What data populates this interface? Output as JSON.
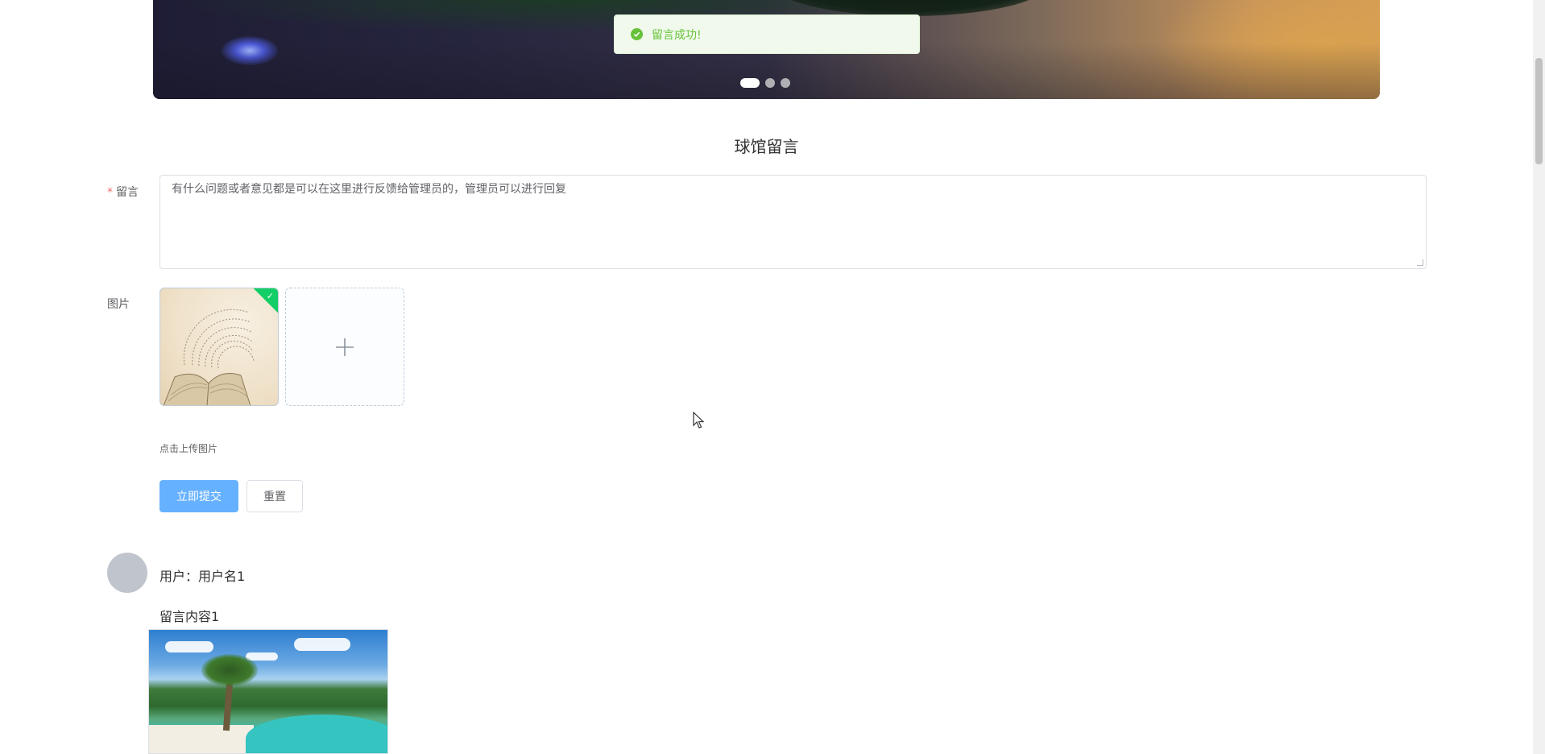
{
  "carousel": {
    "indicator_count": 3,
    "active_index": 0
  },
  "toast": {
    "message": "留言成功!",
    "type": "success",
    "color": "#67c23a"
  },
  "section": {
    "title": "球馆留言"
  },
  "form": {
    "message_label": "留言",
    "required_mark": "*",
    "message_value": "有什么问题或者意见都是可以在这里进行反馈给管理员的，管理员可以进行回复",
    "image_label": "图片",
    "upload_tip": "点击上传图片",
    "submit_label": "立即提交",
    "reset_label": "重置"
  },
  "comments": [
    {
      "user": "用户：用户名1",
      "content": "留言内容1"
    }
  ],
  "colors": {
    "primary": "#66b1ff",
    "success_badge": "#13ce66",
    "required": "#f56c6c"
  }
}
